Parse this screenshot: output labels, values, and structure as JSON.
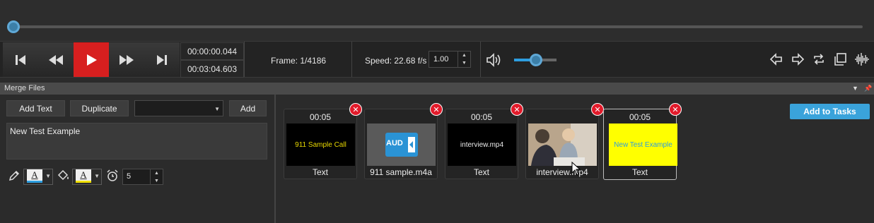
{
  "player": {
    "current_time": "00:00:00.044",
    "total_time": "00:03:04.603",
    "frame": "Frame: 1/4186",
    "speed_label": "Speed: 22.68 f/s",
    "speed_value": "1.00"
  },
  "panel": {
    "title": "Merge Files"
  },
  "editor": {
    "add_text_label": "Add Text",
    "duplicate_label": "Duplicate",
    "add_label": "Add",
    "text_value": "New Test Example",
    "duration_value": "5",
    "text_color": "#2d9ee0",
    "fill_color": "#f0e000"
  },
  "clips": [
    {
      "duration": "00:05",
      "thumb_text": "911 Sample Call",
      "name": "Text"
    },
    {
      "duration": "",
      "thumb_text": "AUD",
      "name": "911 sample.m4a"
    },
    {
      "duration": "00:05",
      "thumb_text": "interview.mp4",
      "name": "Text"
    },
    {
      "duration": "",
      "thumb_text": "",
      "name": "interview.mp4"
    },
    {
      "duration": "00:05",
      "thumb_text": "New Test Example",
      "name": "Text"
    }
  ],
  "actions": {
    "add_to_tasks": "Add to Tasks"
  },
  "colors": {
    "play_button": "#d71f1f",
    "accent": "#3aa3db",
    "close_badge": "#e21b2b"
  }
}
